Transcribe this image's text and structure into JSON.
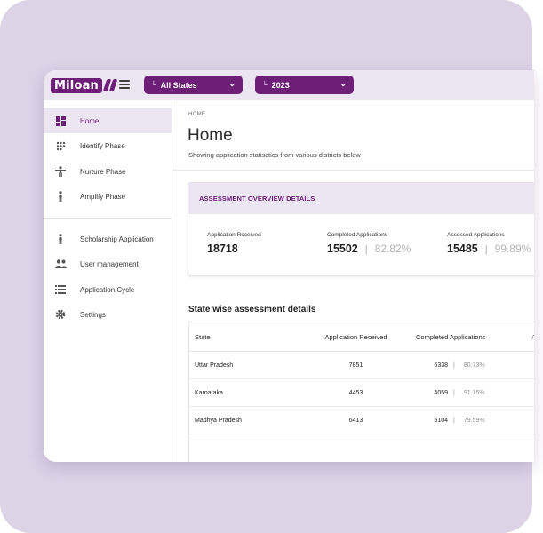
{
  "header": {
    "logo_text": "Miloan",
    "state_dropdown": "All States",
    "year_dropdown": "2023",
    "dropdown_lead": "└"
  },
  "sidebar": {
    "items": [
      {
        "label": "Home",
        "icon": "dashboard-icon",
        "active": true
      },
      {
        "label": "Identify Phase",
        "icon": "grid-dots-icon",
        "active": false
      },
      {
        "label": "Nurture Phase",
        "icon": "person-arms-icon",
        "active": false
      },
      {
        "label": "Amplify Phase",
        "icon": "person-icon",
        "active": false
      },
      {
        "label": "Scholarship Application",
        "icon": "person-icon",
        "active": false
      },
      {
        "label": "User management",
        "icon": "people-icon",
        "active": false
      },
      {
        "label": "Application Cycle",
        "icon": "list-icon",
        "active": false
      },
      {
        "label": "Settings",
        "icon": "gear-icon",
        "active": false
      }
    ]
  },
  "main": {
    "breadcrumb": "HOME",
    "title": "Home",
    "subtitle": "Showing application statisctics from various districts below",
    "overview": {
      "heading": "ASSESSMENT OVERVIEW DETAILS",
      "stats": [
        {
          "label": "Application Received",
          "value": "18718",
          "pct": ""
        },
        {
          "label": "Completed Applications",
          "value": "15502",
          "pct": "82.82%"
        },
        {
          "label": "Assessed Applications",
          "value": "15485",
          "pct": "99.89%"
        }
      ]
    },
    "table": {
      "title": "State wise assessment details",
      "columns": [
        "State",
        "Application Received",
        "Completed Applications",
        "A"
      ],
      "rows": [
        {
          "state": "Uttar Pradesh",
          "received": "7851",
          "completed": "6338",
          "pct": "80.73%"
        },
        {
          "state": "Karnataka",
          "received": "4453",
          "completed": "4059",
          "pct": "91.15%"
        },
        {
          "state": "Madhya Pradesh",
          "received": "6413",
          "completed": "5104",
          "pct": "79.59%"
        }
      ]
    }
  },
  "colors": {
    "brand": "#6d1f78",
    "highlight": "#ece6f3",
    "backdrop": "#dcd3e7"
  }
}
